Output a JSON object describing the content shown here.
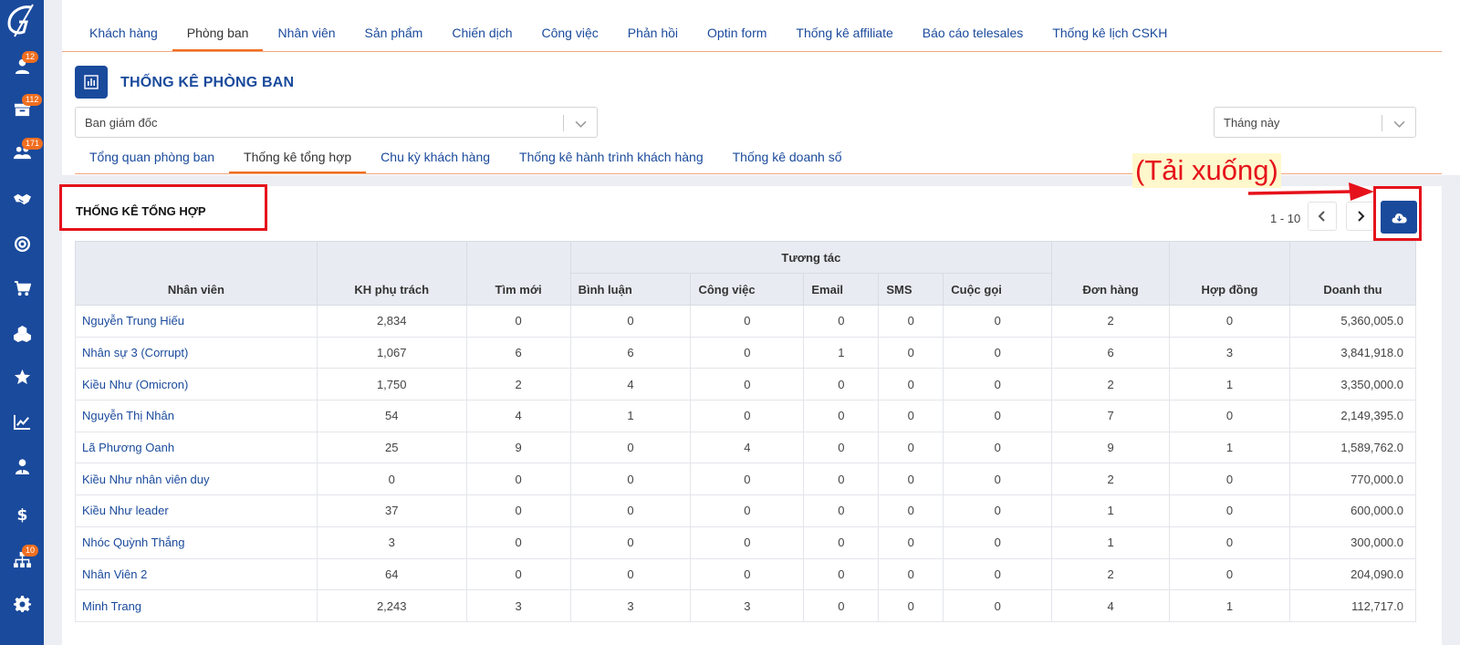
{
  "sidebar": {
    "items": [
      {
        "icon": "user-icon",
        "badge": "12"
      },
      {
        "icon": "inbox-icon",
        "badge": "112"
      },
      {
        "icon": "users-icon",
        "badge": "171"
      },
      {
        "icon": "handshake-icon",
        "badge": ""
      },
      {
        "icon": "target-icon",
        "badge": ""
      },
      {
        "icon": "cart-icon",
        "badge": ""
      },
      {
        "icon": "cubes-icon",
        "badge": ""
      },
      {
        "icon": "star-icon",
        "badge": ""
      },
      {
        "icon": "chart-line-icon",
        "badge": ""
      },
      {
        "icon": "user-tie-icon",
        "badge": ""
      },
      {
        "icon": "dollar-icon",
        "badge": ""
      },
      {
        "icon": "sitemap-icon",
        "badge": "10"
      },
      {
        "icon": "gear-icon",
        "badge": ""
      }
    ]
  },
  "main_tabs": [
    "Khách hàng",
    "Phòng ban",
    "Nhân viên",
    "Sản phẩm",
    "Chiến dịch",
    "Công việc",
    "Phản hồi",
    "Optin form",
    "Thống kê affiliate",
    "Báo cáo telesales",
    "Thống kê lịch CSKH"
  ],
  "main_tab_active": 1,
  "page_title": "THỐNG KÊ PHÒNG BAN",
  "department_select": {
    "value": "Ban giám đốc"
  },
  "period_select": {
    "value": "Tháng này"
  },
  "sub_tabs": [
    "Tổng quan phòng ban",
    "Thống kê tổng hợp",
    "Chu kỳ khách hàng",
    "Thống kê hành trình khách hàng",
    "Thống kê doanh số"
  ],
  "sub_tab_active": 1,
  "section_title": "THỐNG KÊ TỔNG HỢP",
  "pager": {
    "range": "1 - 10"
  },
  "annotation": "(Tải xuống)",
  "table": {
    "headers": {
      "employee": "Nhân viên",
      "customers": "KH phụ trách",
      "new": "Tìm mới",
      "interaction_group": "Tương tác",
      "comments": "Bình luận",
      "tasks": "Công việc",
      "email": "Email",
      "sms": "SMS",
      "calls": "Cuộc gọi",
      "orders": "Đơn hàng",
      "contracts": "Hợp đồng",
      "revenue": "Doanh thu"
    },
    "rows": [
      [
        "Nguyễn Trung Hiếu",
        "2,834",
        "0",
        "0",
        "0",
        "0",
        "0",
        "0",
        "2",
        "0",
        "5,360,005.0"
      ],
      [
        "Nhân sự 3 (Corrupt)",
        "1,067",
        "6",
        "6",
        "0",
        "1",
        "0",
        "0",
        "6",
        "3",
        "3,841,918.0"
      ],
      [
        "Kiều Như (Omicron)",
        "1,750",
        "2",
        "4",
        "0",
        "0",
        "0",
        "0",
        "2",
        "1",
        "3,350,000.0"
      ],
      [
        "Nguyễn Thị Nhân",
        "54",
        "4",
        "1",
        "0",
        "0",
        "0",
        "0",
        "7",
        "0",
        "2,149,395.0"
      ],
      [
        "Lã Phương Oanh",
        "25",
        "9",
        "0",
        "4",
        "0",
        "0",
        "0",
        "9",
        "1",
        "1,589,762.0"
      ],
      [
        "Kiều Như nhân viên duy",
        "0",
        "0",
        "0",
        "0",
        "0",
        "0",
        "0",
        "2",
        "0",
        "770,000.0"
      ],
      [
        "Kiều Như leader",
        "37",
        "0",
        "0",
        "0",
        "0",
        "0",
        "0",
        "1",
        "0",
        "600,000.0"
      ],
      [
        "Nhóc Quỳnh Thắng",
        "3",
        "0",
        "0",
        "0",
        "0",
        "0",
        "0",
        "1",
        "0",
        "300,000.0"
      ],
      [
        "Nhân Viên 2",
        "64",
        "0",
        "0",
        "0",
        "0",
        "0",
        "0",
        "2",
        "0",
        "204,090.0"
      ],
      [
        "Minh Trang",
        "2,243",
        "3",
        "3",
        "3",
        "0",
        "0",
        "0",
        "4",
        "1",
        "112,717.0"
      ]
    ]
  },
  "colors": {
    "primary": "#1a4a9c",
    "accent": "#f06e1f",
    "highlight": "#e5121b",
    "header_bg": "#e8ebf1"
  }
}
